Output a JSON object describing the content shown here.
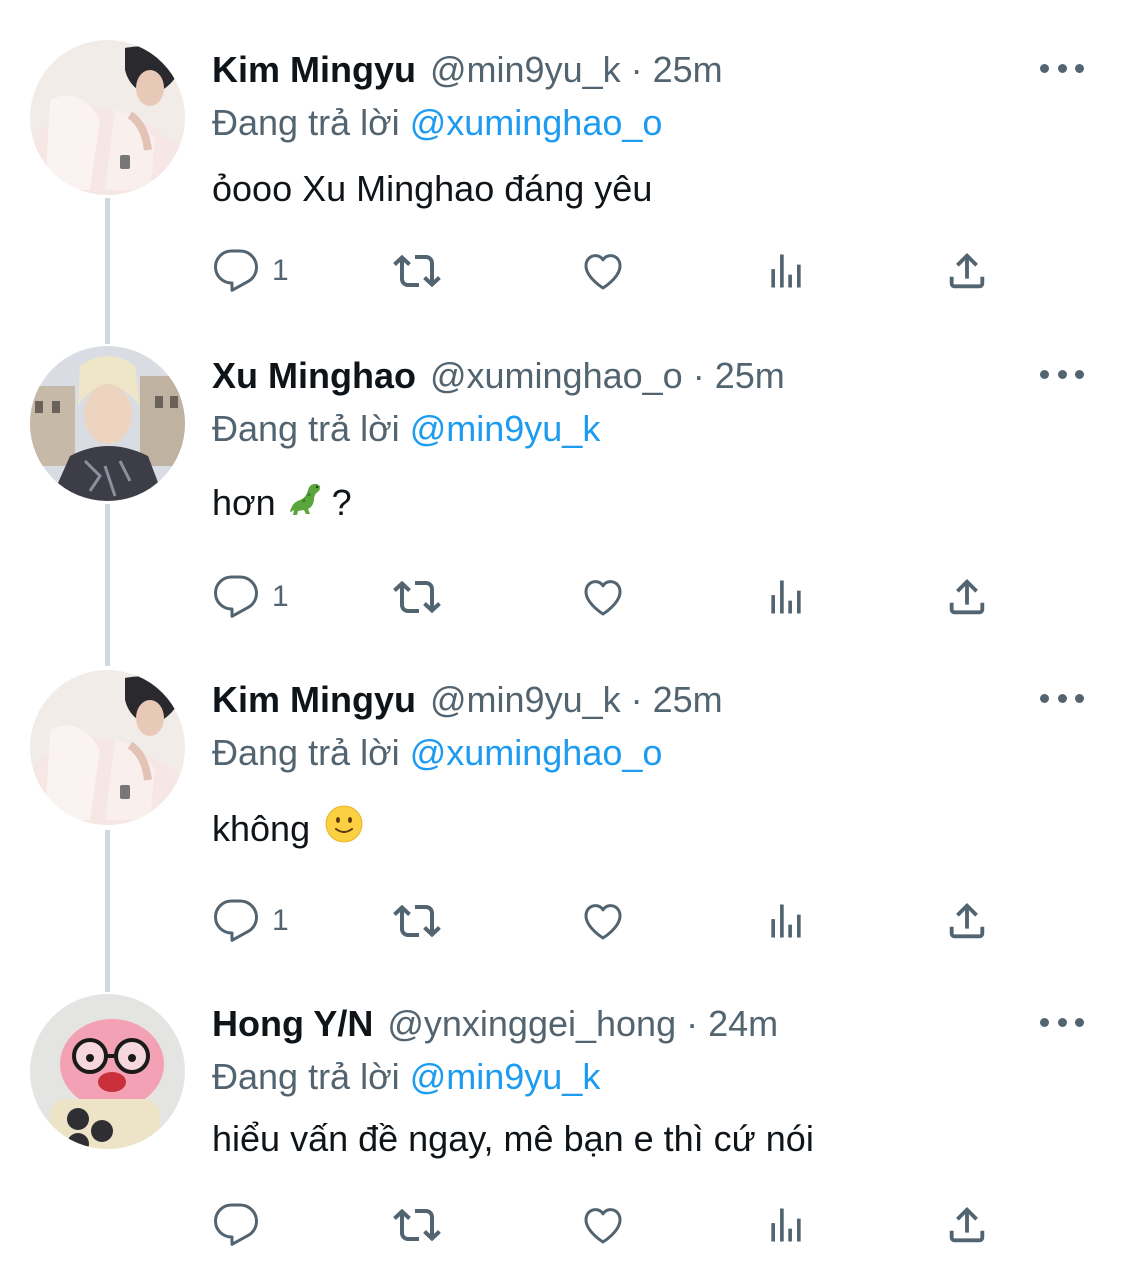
{
  "tweets": [
    {
      "name": "Kim Mingyu",
      "handle": "@min9yu_k",
      "time": "25m",
      "replying_label": "Đang trả lời",
      "replying_to": "@xuminghao_o",
      "text": "ỏooo Xu Minghao đáng yêu",
      "reply_count": "1",
      "avatar": "avatar-kim-mingyu"
    },
    {
      "name": "Xu Minghao",
      "handle": "@xuminghao_o",
      "time": "25m",
      "replying_label": "Đang trả lời",
      "replying_to": "@min9yu_k",
      "text": "hơn",
      "text_suffix": "?",
      "emoji": "dinosaur",
      "reply_count": "1",
      "avatar": "avatar-xu-minghao"
    },
    {
      "name": "Kim Mingyu",
      "handle": "@min9yu_k",
      "time": "25m",
      "replying_label": "Đang trả lời",
      "replying_to": "@xuminghao_o",
      "text": "không",
      "emoji": "slightly-smiling-face",
      "reply_count": "1",
      "avatar": "avatar-kim-mingyu"
    },
    {
      "name": "Hong Y/N",
      "handle": "@ynxinggei_hong",
      "time": "24m",
      "replying_label": "Đang trả lời",
      "replying_to": "@min9yu_k",
      "text": "hiểu vấn đề ngay, mê bạn e thì cứ nói",
      "reply_count": "",
      "avatar": "avatar-hong-yn"
    }
  ],
  "separator": "·",
  "colors": {
    "text": "#0f1419",
    "secondary": "#536471",
    "mention": "#1d9bf0",
    "thread_line": "#cfd9de"
  },
  "icons": [
    "reply-icon",
    "retweet-icon",
    "like-icon",
    "views-icon",
    "share-icon",
    "more-icon"
  ]
}
